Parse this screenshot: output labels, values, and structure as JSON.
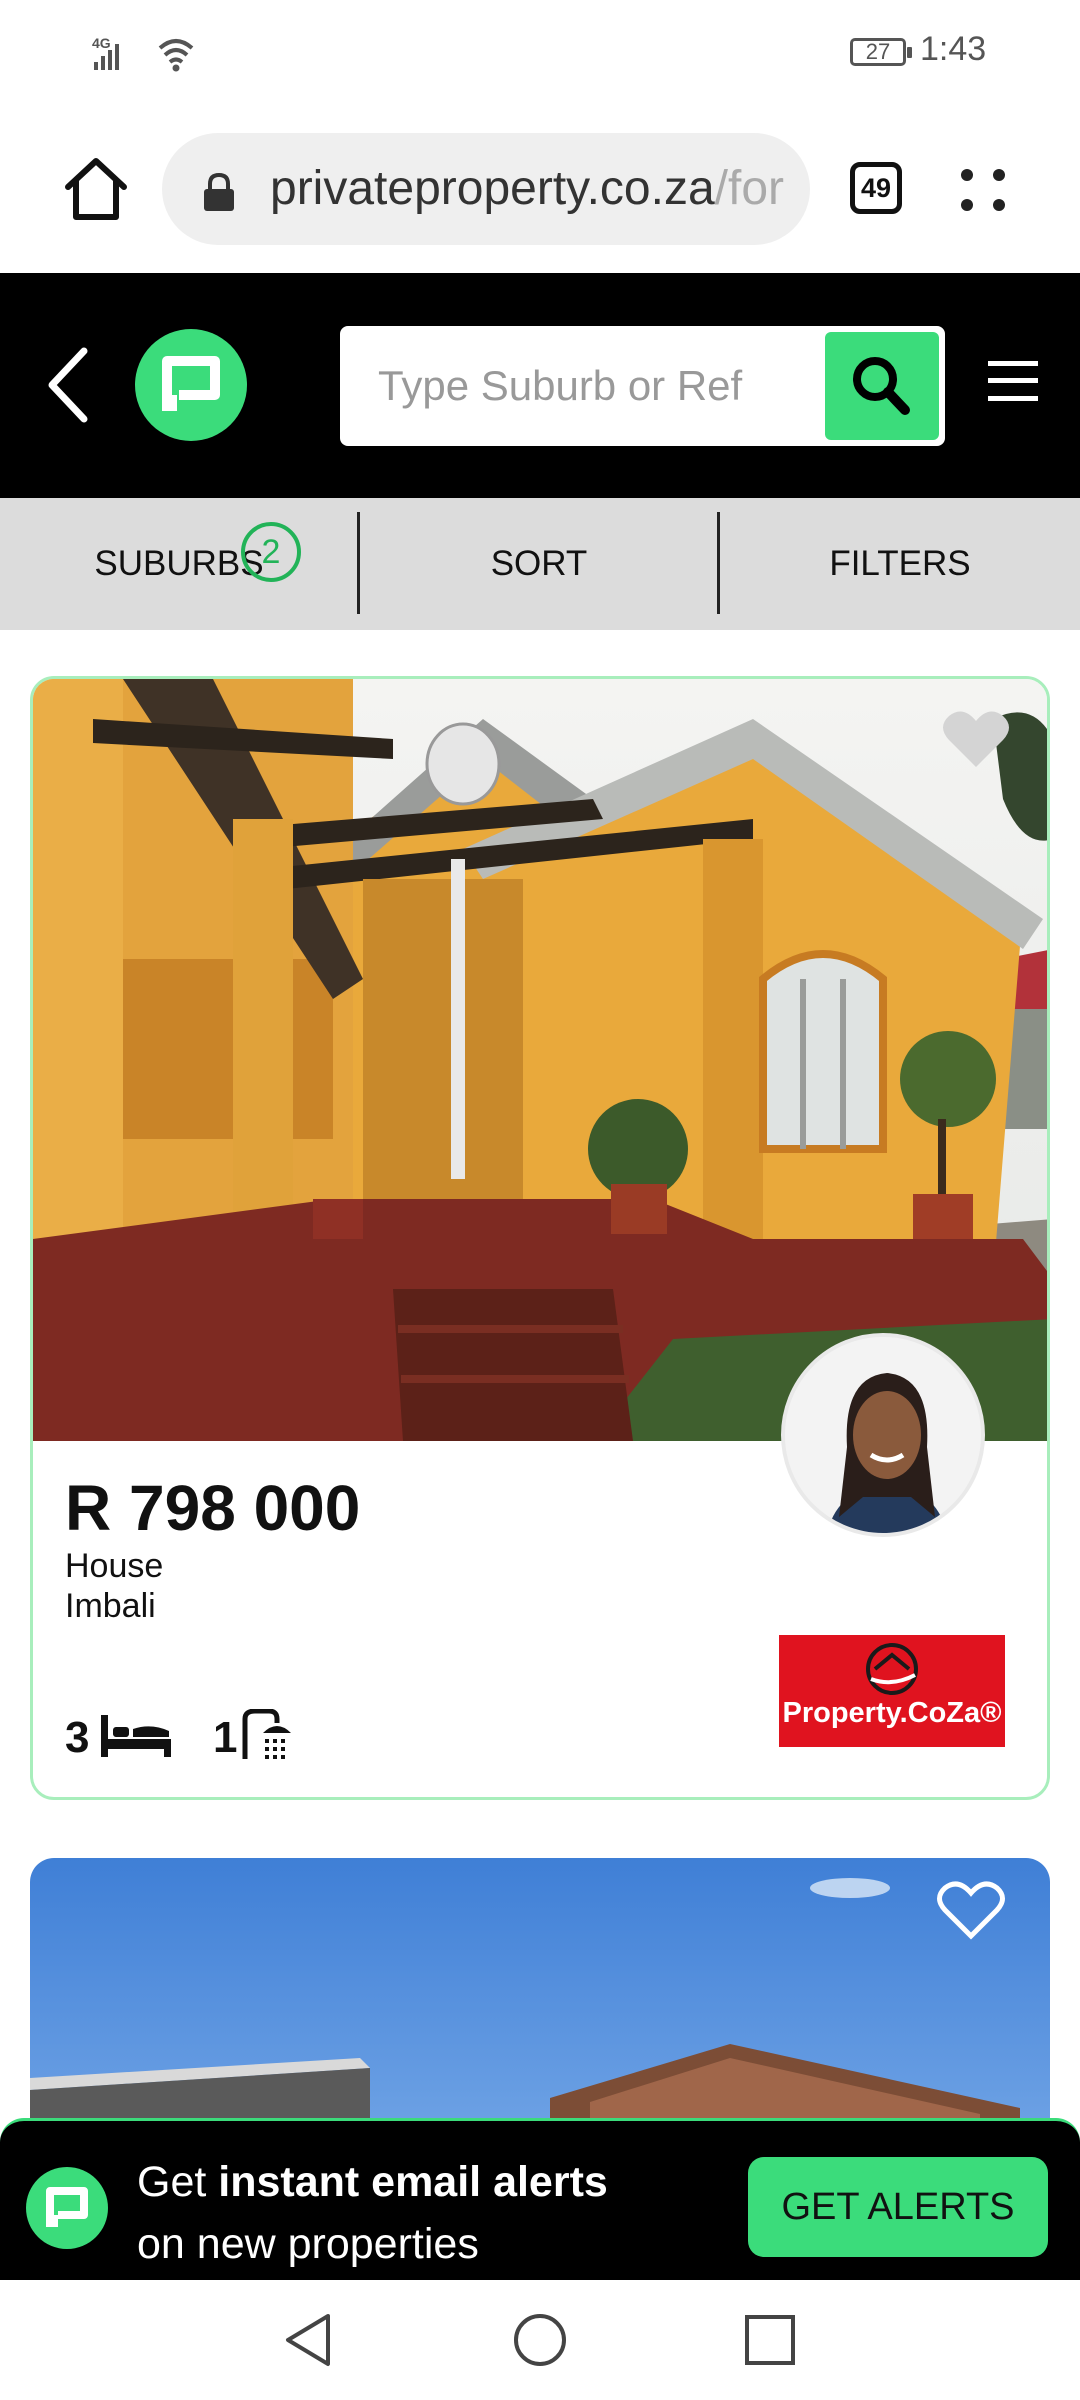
{
  "status_bar": {
    "network": "4G",
    "battery": "27",
    "time": "1:43"
  },
  "browser": {
    "url_main": "privateproperty.co.za",
    "url_faded": "/for",
    "tab_count": "49"
  },
  "header": {
    "search_placeholder": "Type Suburb or Ref"
  },
  "filters": {
    "suburbs_label": "SUBURBS",
    "suburbs_count": "2",
    "sort_label": "SORT",
    "filters_label": "FILTERS"
  },
  "listing": {
    "price": "R 798 000",
    "type": "House",
    "suburb": "Imbali",
    "bedrooms": "3",
    "bathrooms": "1",
    "agency": "Property.CoZa®"
  },
  "alert_banner": {
    "text_prefix": "Get ",
    "text_bold": "instant email alerts",
    "text_line2": "on new properties",
    "button": "GET ALERTS"
  },
  "colors": {
    "brand_green": "#3bdc7b",
    "agency_red": "#e0131f"
  },
  "icons": [
    "signal-icon",
    "wifi-icon",
    "home-icon",
    "lock-icon",
    "more-icon",
    "back-icon",
    "search-icon",
    "menu-icon",
    "heart-icon",
    "bed-icon",
    "shower-icon",
    "nav-back-icon",
    "nav-home-icon",
    "nav-recents-icon"
  ]
}
